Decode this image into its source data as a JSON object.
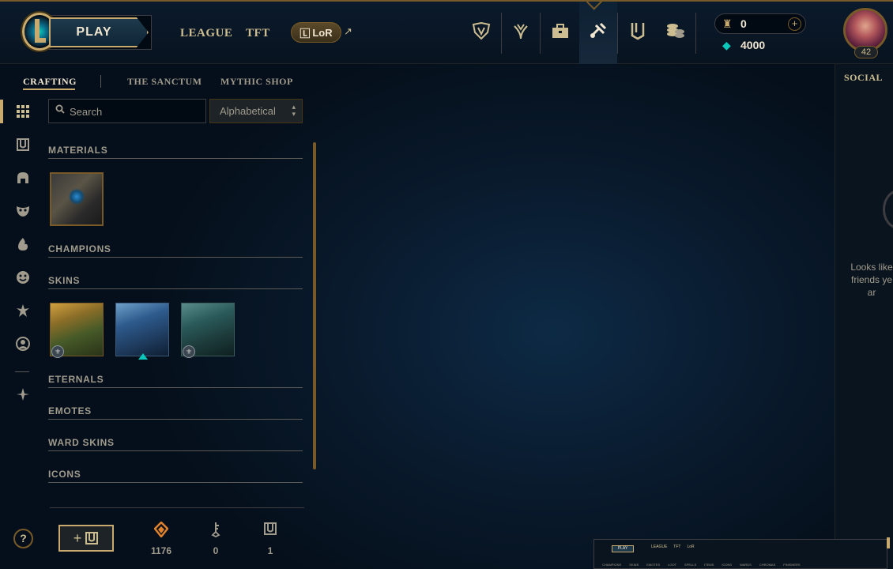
{
  "topbar": {
    "play_label": "PLAY",
    "nav_links": [
      "LEAGUE",
      "TFT"
    ],
    "lor_label": "LoR",
    "lor_external_icon": "external-link-icon",
    "icons": [
      "worlds-icon",
      "tft-icon",
      "store-icon",
      "loot-icon",
      "collection-icon",
      "coins-icon"
    ],
    "active_icon": "loot-icon"
  },
  "currency": {
    "blue_essence_value": "0",
    "rp_value": "4000"
  },
  "profile": {
    "level": "42"
  },
  "subnav": {
    "tabs": [
      "CRAFTING",
      "THE SANCTUM",
      "MYTHIC SHOP"
    ],
    "active": "CRAFTING"
  },
  "rail": {
    "icons": [
      "grid-icon",
      "chest-icon",
      "helmet-icon",
      "mask-icon",
      "emote-icon",
      "smiley-icon",
      "ward-icon",
      "profile-icon",
      "eternals-icon"
    ]
  },
  "search": {
    "placeholder": "Search",
    "sort_value": "Alphabetical"
  },
  "sections": [
    {
      "title": "MATERIALS"
    },
    {
      "title": "CHAMPIONS"
    },
    {
      "title": "SKINS"
    },
    {
      "title": "ETERNALS"
    },
    {
      "title": "EMOTES"
    },
    {
      "title": "WARD SKINS"
    },
    {
      "title": "ICONS"
    }
  ],
  "footer": {
    "orange_essence": "1176",
    "keys": "0",
    "chests": "1"
  },
  "social": {
    "title": "SOCIAL",
    "message": "Looks like\nfriends ye\nar"
  },
  "mini_preview": {
    "play_label": "PLAY",
    "nav": [
      "LEAGUE",
      "TFT"
    ],
    "lor": "LoR",
    "tabs": [
      "CHAMPIONS",
      "SKINS",
      "EMOTES",
      "LOOT",
      "SPELLS",
      "ITEMS",
      "ICONS",
      "WARDS",
      "CHROMAS",
      "FINISHERS"
    ]
  },
  "colors": {
    "gold": "#c8aa6e",
    "gold_dark": "#785a28",
    "teal": "#0ac8b9",
    "background": "#010a13"
  }
}
